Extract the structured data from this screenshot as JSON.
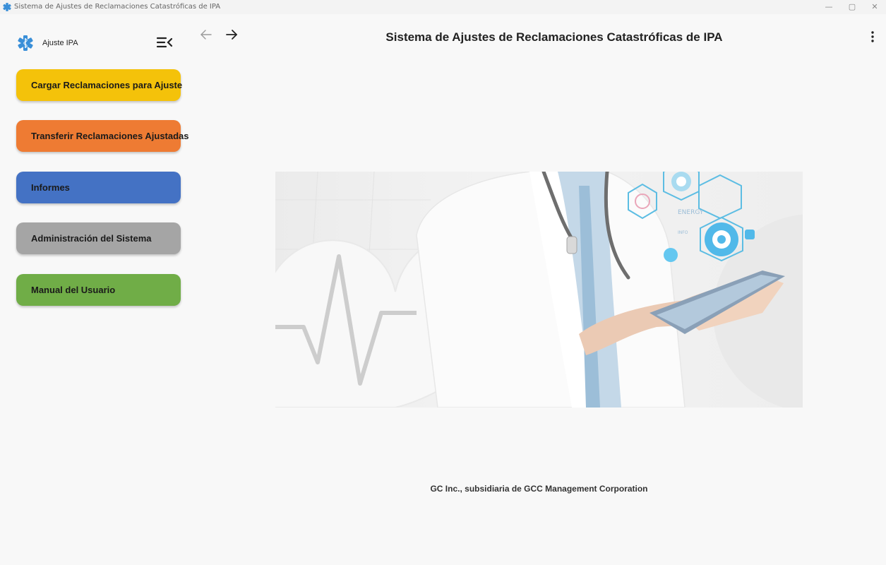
{
  "window": {
    "title": "Sistema de Ajustes de Reclamaciones Catastróficas de IPA",
    "controls": [
      "—",
      "▢",
      "✕"
    ]
  },
  "brand": {
    "name": "Ajuste IPA",
    "logo_icon": "medical-star-of-life-icon",
    "logo_color": "#3a8fd8"
  },
  "sidebar": {
    "collapse_icon": "menu-collapse-icon",
    "items": [
      {
        "label": "Cargar Reclamaciones para Ajuste",
        "color": "#f4c20a"
      },
      {
        "label": "Transferir Reclamaciones Ajustadas",
        "color": "#ee7b33"
      },
      {
        "label": "Informes",
        "color": "#4472c4"
      },
      {
        "label": "Administración del Sistema",
        "color": "#a5a5a5"
      },
      {
        "label": "Manual del Usuario",
        "color": "#70ad47"
      }
    ]
  },
  "header": {
    "title": "Sistema de Ajustes de Reclamaciones Catastróficas de IPA",
    "back_icon": "arrow-left-icon",
    "forward_icon": "arrow-right-icon",
    "more_icon": "more-vertical-icon"
  },
  "hero": {
    "image": "doctor-with-tablet-illustration",
    "hud_text": [
      "ENERGY",
      "INFO"
    ]
  },
  "footer": {
    "text": "GC Inc., subsidiaria de GCC Management Corporation"
  }
}
